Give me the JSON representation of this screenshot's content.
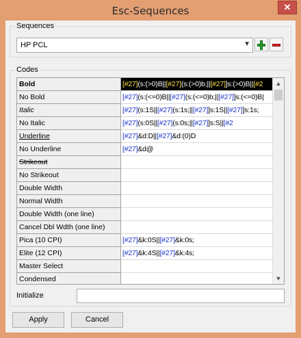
{
  "window": {
    "title": "Esc-Sequences",
    "close_glyph": "✕"
  },
  "sequences": {
    "label": "Sequences",
    "selected": "HP PCL",
    "add_label": "add",
    "remove_label": "remove"
  },
  "codes": {
    "label": "Codes",
    "rows": [
      {
        "name": "Bold",
        "selected": true,
        "style": "bold",
        "parts": [
          [
            "e",
            "[#27]"
          ],
          [
            "t",
            "(s:(>0)B||"
          ],
          [
            "e",
            "[#27]"
          ],
          [
            "t",
            "(s:(>0)b;||"
          ],
          [
            "e",
            "[#27]"
          ],
          [
            "t",
            "]s:(>0)B||"
          ],
          [
            "e",
            "[#2"
          ]
        ]
      },
      {
        "name": "No Bold",
        "style": "",
        "parts": [
          [
            "e",
            "[#27]"
          ],
          [
            "t",
            "(s:(<=0)B||"
          ],
          [
            "e",
            "[#27]"
          ],
          [
            "t",
            "(s:(<=0)b;||"
          ],
          [
            "e",
            "[#27]"
          ],
          [
            "t",
            "]s:(<=0)B|"
          ]
        ]
      },
      {
        "name": "Italic",
        "style": "italic",
        "parts": [
          [
            "e",
            "[#27]"
          ],
          [
            "t",
            "(s:1S||"
          ],
          [
            "e",
            "[#27]"
          ],
          [
            "t",
            "(s:1s;||"
          ],
          [
            "e",
            "[#27]"
          ],
          [
            "t",
            "]s:1S||"
          ],
          [
            "e",
            "[#27]"
          ],
          [
            "t",
            "]s:1s;"
          ]
        ]
      },
      {
        "name": "No Italic",
        "style": "",
        "parts": [
          [
            "e",
            "[#27]"
          ],
          [
            "t",
            "(s:0S||"
          ],
          [
            "e",
            "[#27]"
          ],
          [
            "t",
            "(s:0s;||"
          ],
          [
            "e",
            "[#27]"
          ],
          [
            "t",
            "]s:S||"
          ],
          [
            "e",
            "[#2"
          ]
        ]
      },
      {
        "name": "Underline",
        "style": "underline",
        "parts": [
          [
            "e",
            "[#27]"
          ],
          [
            "t",
            "&d:D||"
          ],
          [
            "e",
            "[#27]"
          ],
          [
            "t",
            "&d:(0)D"
          ]
        ]
      },
      {
        "name": "No Underline",
        "style": "",
        "parts": [
          [
            "e",
            "[#27]"
          ],
          [
            "t",
            "&d@"
          ]
        ]
      },
      {
        "name": "Strikeout",
        "style": "strike",
        "parts": []
      },
      {
        "name": "No Strikeout",
        "style": "",
        "parts": []
      },
      {
        "name": "Double Width",
        "style": "",
        "parts": []
      },
      {
        "name": "Normal Width",
        "style": "",
        "parts": []
      },
      {
        "name": "Double Width (one line)",
        "style": "",
        "parts": []
      },
      {
        "name": "Cancel Dbl Wdth (one line)",
        "style": "",
        "parts": []
      },
      {
        "name": "Pica (10 CPI)",
        "style": "",
        "parts": [
          [
            "e",
            "[#27]"
          ],
          [
            "t",
            "&k:0S||"
          ],
          [
            "e",
            "[#27]"
          ],
          [
            "t",
            "&k:0s;"
          ]
        ]
      },
      {
        "name": "Elite (12 CPI)",
        "style": "",
        "parts": [
          [
            "e",
            "[#27]"
          ],
          [
            "t",
            "&k:4S||"
          ],
          [
            "e",
            "[#27]"
          ],
          [
            "t",
            "&k:4s;"
          ]
        ]
      },
      {
        "name": "Master Select",
        "style": "",
        "parts": []
      },
      {
        "name": "Condensed",
        "style": "",
        "parts": []
      }
    ]
  },
  "initialize": {
    "label": "Initialize",
    "value": ""
  },
  "buttons": {
    "apply": "Apply",
    "cancel": "Cancel"
  },
  "colors": {
    "escape_code": "#1a33c9",
    "selected_escape_code": "#ffe14d",
    "plus": "#2da12d",
    "minus": "#e02424"
  }
}
